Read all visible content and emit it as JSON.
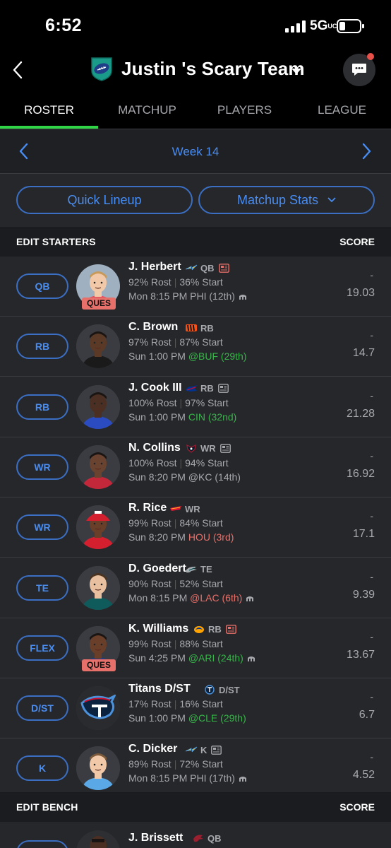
{
  "status_bar": {
    "time": "6:52",
    "network": "5G",
    "network_suffix": "UC"
  },
  "header": {
    "team_name": "Justin 's Scary Team"
  },
  "tabs": [
    {
      "label": "ROSTER",
      "active": true
    },
    {
      "label": "MATCHUP",
      "active": false
    },
    {
      "label": "PLAYERS",
      "active": false
    },
    {
      "label": "LEAGUE",
      "active": false
    }
  ],
  "week": {
    "label": "Week 14"
  },
  "actions": {
    "quick_lineup": "Quick Lineup",
    "matchup_stats": "Matchup Stats"
  },
  "starters_section": {
    "title": "EDIT STARTERS",
    "score_label": "SCORE"
  },
  "bench_section": {
    "title": "EDIT BENCH",
    "score_label": "SCORE"
  },
  "colors": {
    "accent_blue": "#4a8df0",
    "active_tab": "#2fd544",
    "positive": "#38b44a",
    "negative": "#e8706a"
  },
  "starters": [
    {
      "slot": "QB",
      "name": "J. Herbert",
      "team_icon": "chargers-bolt-icon",
      "pos": "QB",
      "has_news": true,
      "status": "QUES",
      "rost": "92% Rost",
      "start": "36% Start",
      "game_time": "Mon 8:15 PM",
      "opp": "PHI (12th)",
      "opp_tone": "gray",
      "weather": true,
      "score": "19.03",
      "dash": "-"
    },
    {
      "slot": "RB",
      "name": "C. Brown",
      "team_icon": "bengals-icon",
      "pos": "RB",
      "has_news": false,
      "status": "",
      "rost": "97% Rost",
      "start": "87% Start",
      "game_time": "Sun 1:00 PM",
      "opp": "@BUF (29th)",
      "opp_tone": "green",
      "weather": false,
      "score": "14.7",
      "dash": "-"
    },
    {
      "slot": "RB",
      "name": "J. Cook III",
      "team_icon": "bills-icon",
      "pos": "RB",
      "has_news": true,
      "status": "",
      "rost": "100% Rost",
      "start": "97% Start",
      "game_time": "Sun 1:00 PM",
      "opp": "CIN (32nd)",
      "opp_tone": "green",
      "weather": false,
      "score": "21.28",
      "dash": "-"
    },
    {
      "slot": "WR",
      "name": "N. Collins",
      "team_icon": "texans-icon",
      "pos": "WR",
      "has_news": true,
      "status": "",
      "rost": "100% Rost",
      "start": "94% Start",
      "game_time": "Sun 8:20 PM",
      "opp": "@KC (14th)",
      "opp_tone": "gray",
      "weather": false,
      "score": "16.92",
      "dash": "-"
    },
    {
      "slot": "WR",
      "name": "R. Rice",
      "team_icon": "chiefs-icon",
      "pos": "WR",
      "has_news": false,
      "status": "",
      "rost": "99% Rost",
      "start": "84% Start",
      "game_time": "Sun 8:20 PM",
      "opp": "HOU (3rd)",
      "opp_tone": "red",
      "weather": false,
      "score": "17.1",
      "dash": "-"
    },
    {
      "slot": "TE",
      "name": "D. Goedert",
      "team_icon": "eagles-icon",
      "pos": "TE",
      "has_news": false,
      "status": "",
      "rost": "90% Rost",
      "start": "52% Start",
      "game_time": "Mon 8:15 PM",
      "opp": "@LAC (6th)",
      "opp_tone": "red",
      "weather": true,
      "score": "9.39",
      "dash": "-"
    },
    {
      "slot": "FLEX",
      "name": "K. Williams",
      "team_icon": "rams-icon",
      "pos": "RB",
      "has_news": true,
      "status": "QUES",
      "rost": "99% Rost",
      "start": "88% Start",
      "game_time": "Sun 4:25 PM",
      "opp": "@ARI (24th)",
      "opp_tone": "green",
      "weather": true,
      "score": "13.67",
      "dash": "-"
    },
    {
      "slot": "D/ST",
      "name": "Titans D/ST",
      "team_icon": "titans-icon",
      "pos": "D/ST",
      "has_news": false,
      "status": "",
      "rost": "17% Rost",
      "start": "16% Start",
      "game_time": "Sun 1:00 PM",
      "opp": "@CLE (29th)",
      "opp_tone": "green",
      "weather": false,
      "score": "6.7",
      "dash": "-"
    },
    {
      "slot": "K",
      "name": "C. Dicker",
      "team_icon": "chargers-bolt-icon",
      "pos": "K",
      "has_news": true,
      "status": "",
      "rost": "89% Rost",
      "start": "72% Start",
      "game_time": "Mon 8:15 PM",
      "opp": "PHI (17th)",
      "opp_tone": "gray",
      "weather": true,
      "score": "4.52",
      "dash": "-"
    }
  ],
  "bench": [
    {
      "name": "J. Brissett",
      "pos": "QB"
    }
  ]
}
